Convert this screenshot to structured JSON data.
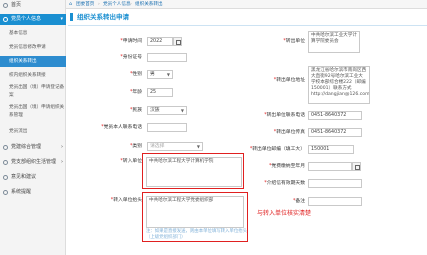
{
  "sidebar": {
    "items": [
      {
        "label": "首页"
      },
      {
        "label": "党员个人信息"
      },
      {
        "label": "基本信息"
      },
      {
        "label": "党员信息修改申请"
      },
      {
        "label": "组织关系转出"
      },
      {
        "label": "校内组织关系转接"
      },
      {
        "label": "党员出国（境）申请登记备案"
      },
      {
        "label": "党员出国（境）申请组织关系管理"
      },
      {
        "label": "党员流出"
      },
      {
        "label": "党建综合管理"
      },
      {
        "label": "党支部组织生活管理"
      },
      {
        "label": "意见和建议"
      },
      {
        "label": "系统提醒"
      }
    ]
  },
  "breadcrumb": {
    "home": "团委首页",
    "sep1": "›",
    "level1": "党员个人信息",
    "sep2": "›",
    "level2": "组织关系转出"
  },
  "header": {
    "title": "组织关系转出申请"
  },
  "form": {
    "apply_date_label": "申请时间",
    "apply_date_value": "2022",
    "id_label": "身份证号",
    "gender_label": "性别",
    "gender_value": "男",
    "age_label": "年龄",
    "age_value": "25",
    "ethnicity_label": "民族",
    "ethnicity_value": "汉族",
    "phone_label": "党员本人联系电话",
    "category_label": "类别",
    "category_value": "请选择",
    "transfer_in_label": "转入单位",
    "transfer_in_value": "中共哈尔滨工程大学计算机学院",
    "transfer_in_title_label": "转入单位抬头",
    "transfer_in_title_value": "中共哈尔滨工程大学党委组织部",
    "transfer_in_title_hint": "注：如果是直接发送，则由本单位填写转入单位抬头（上级党组织部门）",
    "transfer_out_label": "转出单位",
    "transfer_out_value": "中共哈尔滨工业大学计算学院委员会",
    "out_address_label": "转出单位地址",
    "out_address_value": "黑龙江省哈尔滨市南岗区西大直街92号哈尔滨工业大学校本部综合楼222（邮编150001）联系方式 http://dangjian@126.com）",
    "out_phone_label": "转出单位联系电话",
    "out_phone_value": "0451-8640372",
    "out_fax_label": "转出单位传真",
    "out_fax_value": "0451-8640372",
    "out_zip_label": "转出单位邮编（填工大）",
    "out_zip_value": "150001",
    "fee_month_label": "党费缴纳至年月",
    "valid_days_label": "介绍信有效期天数",
    "remark_label": "备注",
    "remark_value": "",
    "annotation": "与转入单位核实清楚"
  },
  "colors": {
    "accent": "#1a8fd1",
    "highlight": "#e02020"
  }
}
